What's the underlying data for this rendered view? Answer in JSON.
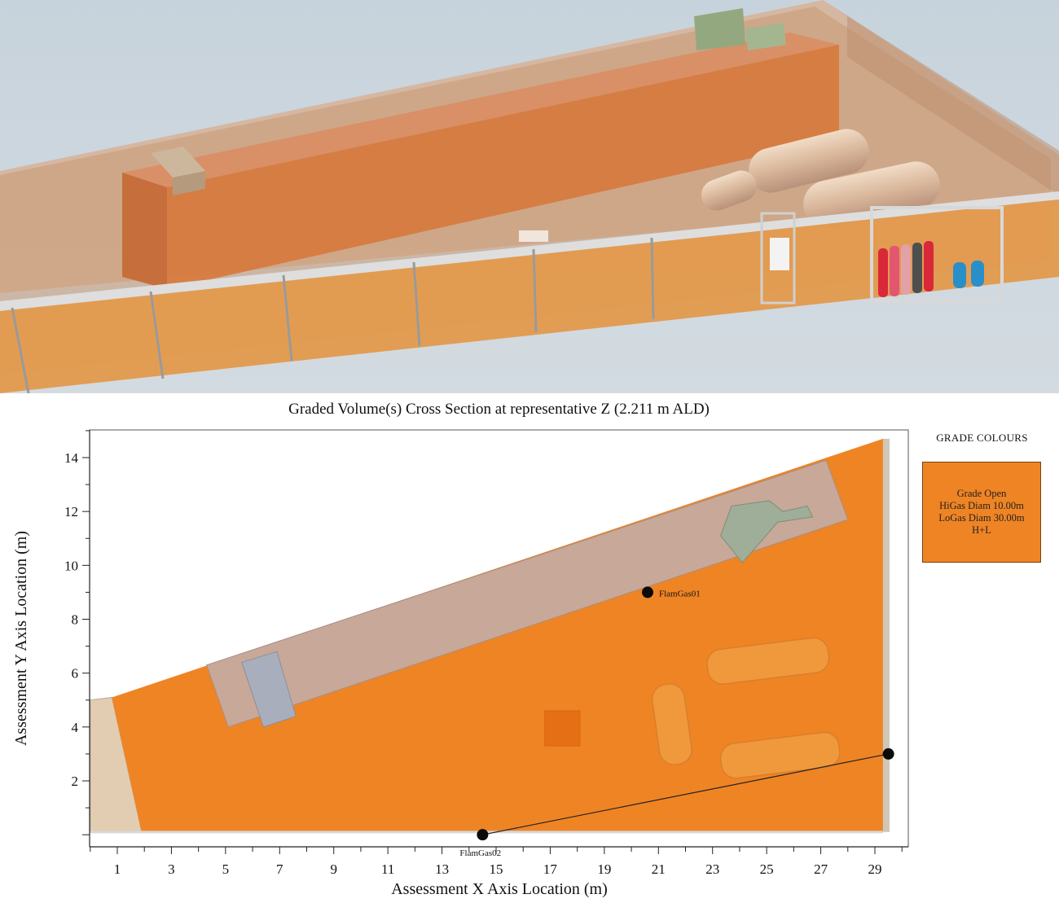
{
  "scene": {
    "description_hidden": ""
  },
  "colors": {
    "grade_open": "#ef8424",
    "wall_block": "#c8a898",
    "fence_panel": "#e39a4c",
    "background_3d": "#c9d4dc"
  },
  "chart_data": {
    "type": "scatter",
    "title": "Graded Volume(s) Cross Section at representative Z (2.211 m ALD)",
    "xlabel": "Assessment X Axis Location (m)",
    "ylabel": "Assessment Y Axis Location (m)",
    "xlim": [
      0,
      30
    ],
    "ylim": [
      -0.5,
      15
    ],
    "x_ticks": [
      1,
      3,
      5,
      7,
      9,
      11,
      13,
      15,
      17,
      19,
      21,
      23,
      25,
      27,
      29
    ],
    "y_ticks": [
      2,
      4,
      6,
      8,
      10,
      12,
      14
    ],
    "grid": false,
    "legend_position": "right",
    "legend": {
      "title": "GRADE COLOURS",
      "entries": [
        {
          "lines": [
            "Grade Open",
            "HiGas Diam 10.00m",
            "LoGas Diam 30.00m",
            "H+L"
          ],
          "color": "#ef8424"
        }
      ]
    },
    "points": [
      {
        "label": "FlamGas01",
        "x": 20.6,
        "y": 9.0
      },
      {
        "label": "FlamGas02",
        "x": 14.5,
        "y": 0.0
      },
      {
        "label": "",
        "x": 29.5,
        "y": 3.0
      }
    ],
    "line_segment": {
      "from": [
        14.5,
        0.0
      ],
      "to": [
        29.5,
        3.0
      ]
    },
    "regions": {
      "open_grade": [
        [
          0.8,
          5.1
        ],
        [
          29.3,
          14.7
        ],
        [
          29.3,
          0.1
        ],
        [
          1.9,
          0.1
        ]
      ],
      "building_strip": [
        [
          4.3,
          6.3
        ],
        [
          27.2,
          13.9
        ],
        [
          28.0,
          11.7
        ],
        [
          5.1,
          4.0
        ]
      ],
      "left_area": [
        [
          0.0,
          5.0
        ],
        [
          0.8,
          5.1
        ],
        [
          1.9,
          0.1
        ],
        [
          0.0,
          0.1
        ]
      ]
    }
  }
}
